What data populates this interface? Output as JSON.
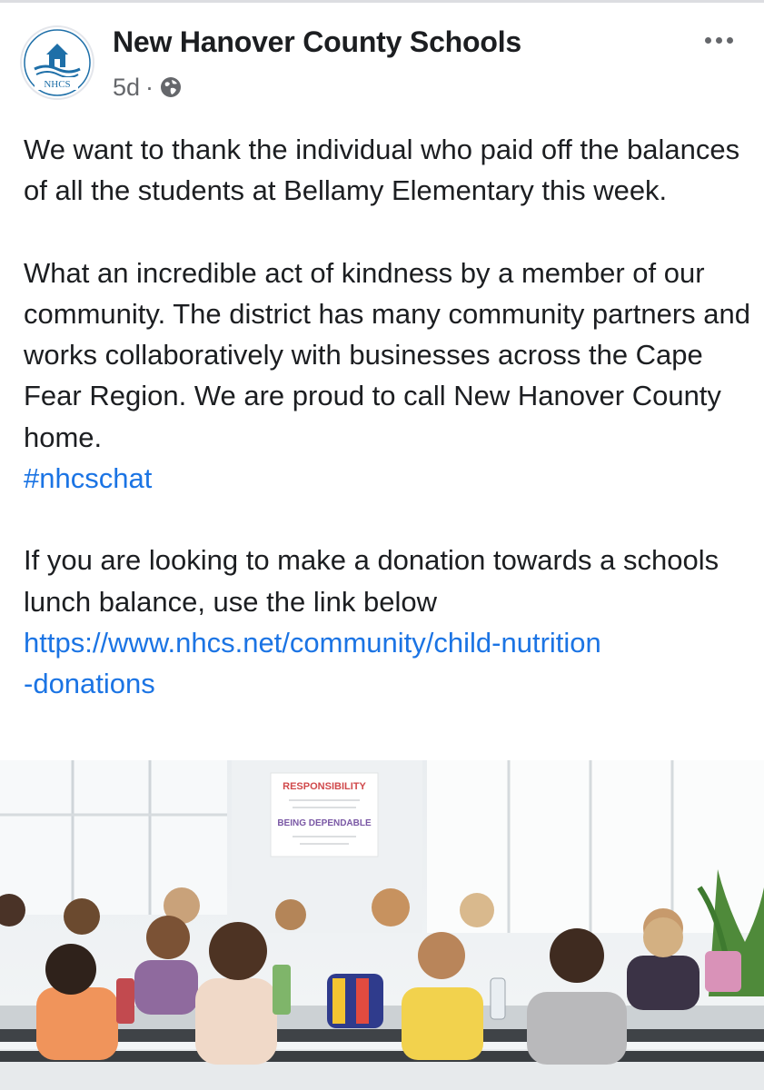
{
  "post": {
    "author": "New Hanover County Schools",
    "avatar_text": "NHCS",
    "time": "5d",
    "separator": "·",
    "privacy_icon": "globe-icon",
    "menu_icon": "more-options-icon",
    "paragraph1": "We want to thank the individual who paid off the balances of all the students at Bellamy Elementary this week.",
    "paragraph2": "What an incredible act of kindness by a member of our community. The district has many community partners and works collaboratively with businesses across the Cape Fear Region. We are proud to call New Hanover County home.",
    "hashtag": "#nhcschat",
    "paragraph3": "If you are looking to make a donation towards a schools lunch balance, use the link below",
    "link_line1": "https://www.nhcs.net/community/child-nutrition",
    "link_line2": "-donations"
  },
  "photo": {
    "poster_line1": "RESPONSIBILITY",
    "poster_line2": "BEING DEPENDABLE"
  },
  "colors": {
    "link": "#1b74e4",
    "brand_blue": "#1e6fa8",
    "text": "#1c1e21",
    "meta": "#65676b"
  }
}
